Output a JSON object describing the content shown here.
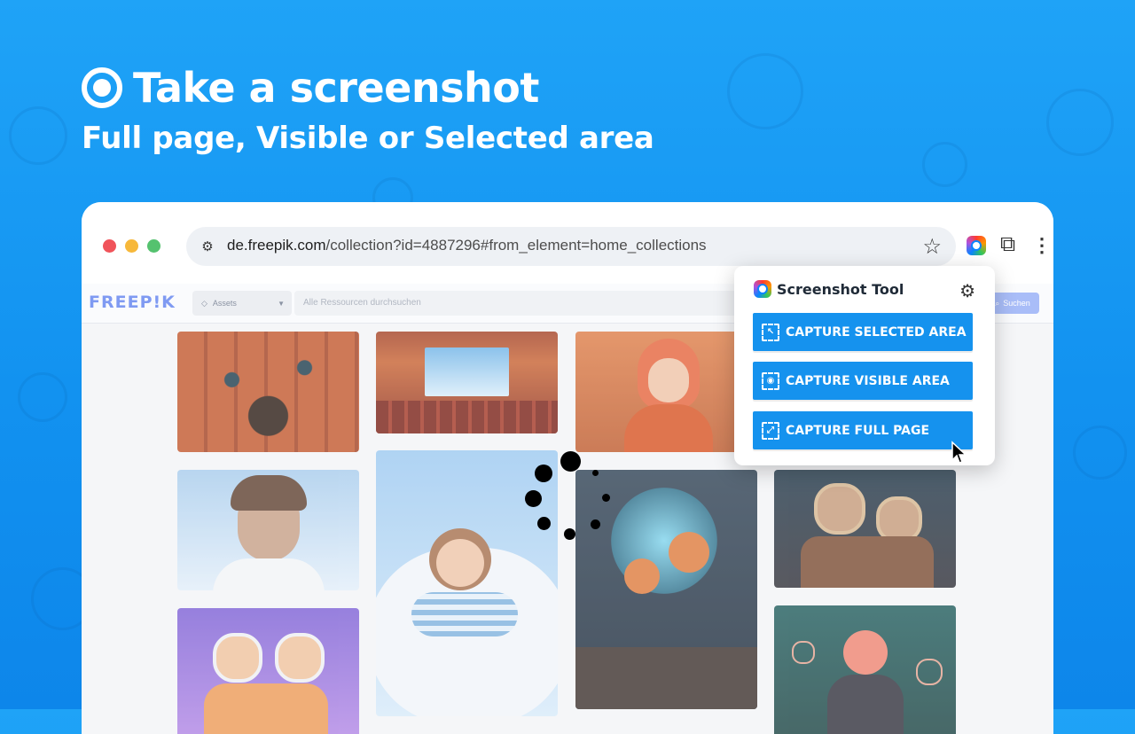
{
  "hero": {
    "title": "Take a screenshot",
    "subtitle": "Full page, Visible or Selected area"
  },
  "browser": {
    "url_host": "de.freepik.com",
    "url_path": "/collection?id=4887296#from_element=home_collections"
  },
  "site": {
    "logo": "FREEP!K",
    "asset_select": "Assets",
    "search_placeholder": "Alle Ressourcen durchsuchen",
    "search_button": "Suchen"
  },
  "popup": {
    "title": "Screenshot Tool",
    "buttons": [
      {
        "label": "CAPTURE SELECTED AREA",
        "icon": "selection-icon"
      },
      {
        "label": "CAPTURE VISIBLE AREA",
        "icon": "eye-icon"
      },
      {
        "label": "CAPTURE FULL PAGE",
        "icon": "expand-icon"
      }
    ]
  },
  "colors": {
    "background": "#1292f0",
    "button": "#1592ee",
    "site_logo": "#7f9af2"
  }
}
